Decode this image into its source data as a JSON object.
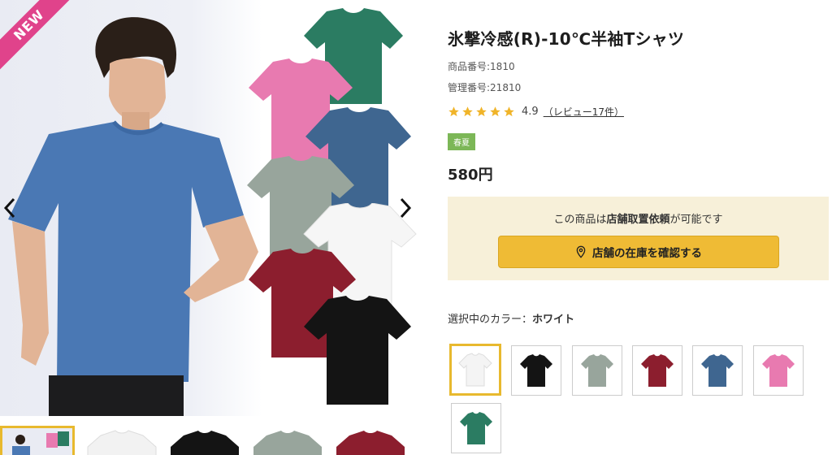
{
  "product": {
    "title": "氷撃冷感(R)-10℃半袖Tシャツ",
    "item_number": "商品番号:1810",
    "management_number": "管理番号:21810",
    "rating": "4.9",
    "review_link": "（レビュー17件）",
    "season_tag": "春夏",
    "price": "580円"
  },
  "badge": {
    "new": "NEW"
  },
  "store": {
    "text_prefix": "この商品は",
    "text_bold": "店舗取置依頼",
    "text_suffix": "が可能です",
    "button_label": "店舗の在庫を確認する"
  },
  "color_selection": {
    "label": "選択中のカラー：",
    "selected": "ホワイト"
  },
  "swatches": [
    {
      "color": "#f4f4f4",
      "name": "white"
    },
    {
      "color": "#141414",
      "name": "black"
    },
    {
      "color": "#98a59c",
      "name": "gray"
    },
    {
      "color": "#8c1e2e",
      "name": "wine"
    },
    {
      "color": "#3f6690",
      "name": "navy-blue"
    },
    {
      "color": "#e87ab0",
      "name": "pink"
    },
    {
      "color": "#2b7c62",
      "name": "green"
    }
  ],
  "colors": {
    "accent_yellow": "#efbb35",
    "selected_border": "#e8b92e",
    "season_green": "#7cb757",
    "new_badge_pink": "#e0438b",
    "store_box_bg": "#f7f0d9"
  }
}
